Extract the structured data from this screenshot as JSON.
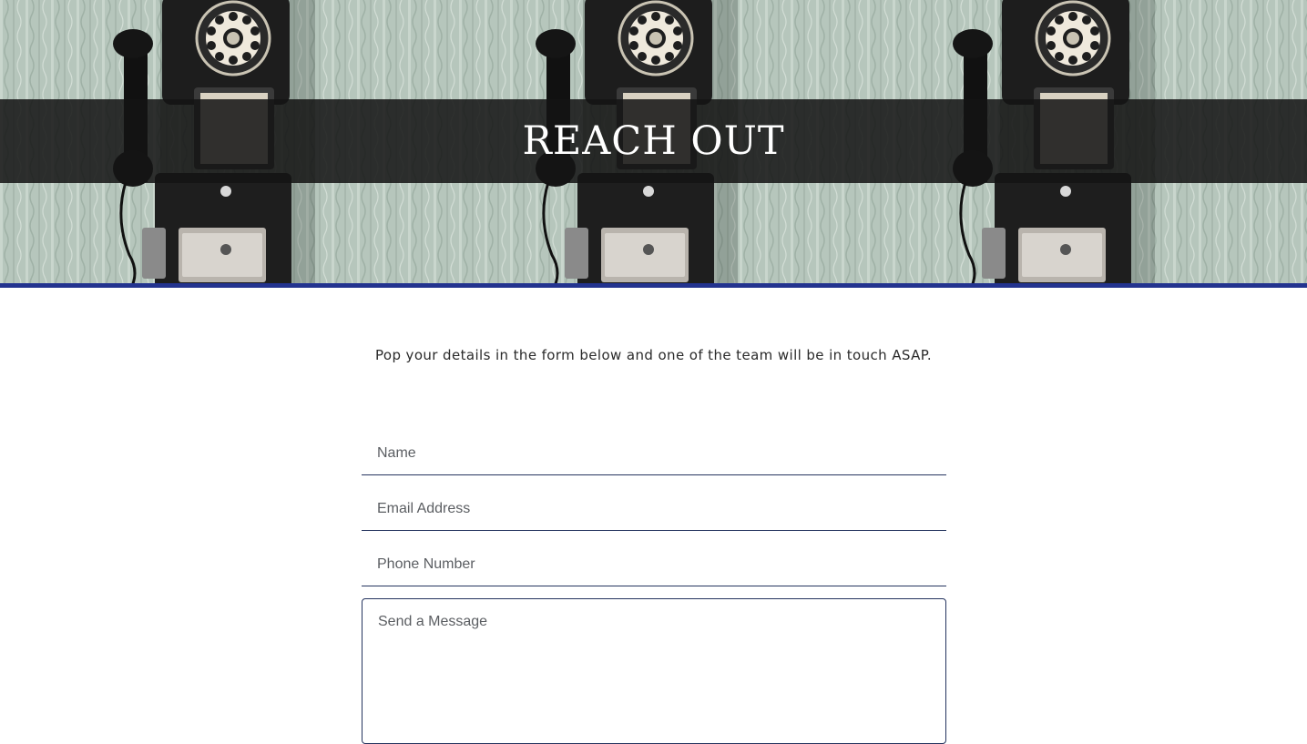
{
  "hero": {
    "title": "REACH OUT",
    "image": "three vintage rotary payphones mounted on patterned wallpaper",
    "accent_color": "#23338f"
  },
  "intro": {
    "text": "Pop your details in the form below and one of the team will be in touch ASAP."
  },
  "form": {
    "name_placeholder": "Name",
    "email_placeholder": "Email Address",
    "phone_placeholder": "Phone Number",
    "message_placeholder": "Send a Message"
  }
}
